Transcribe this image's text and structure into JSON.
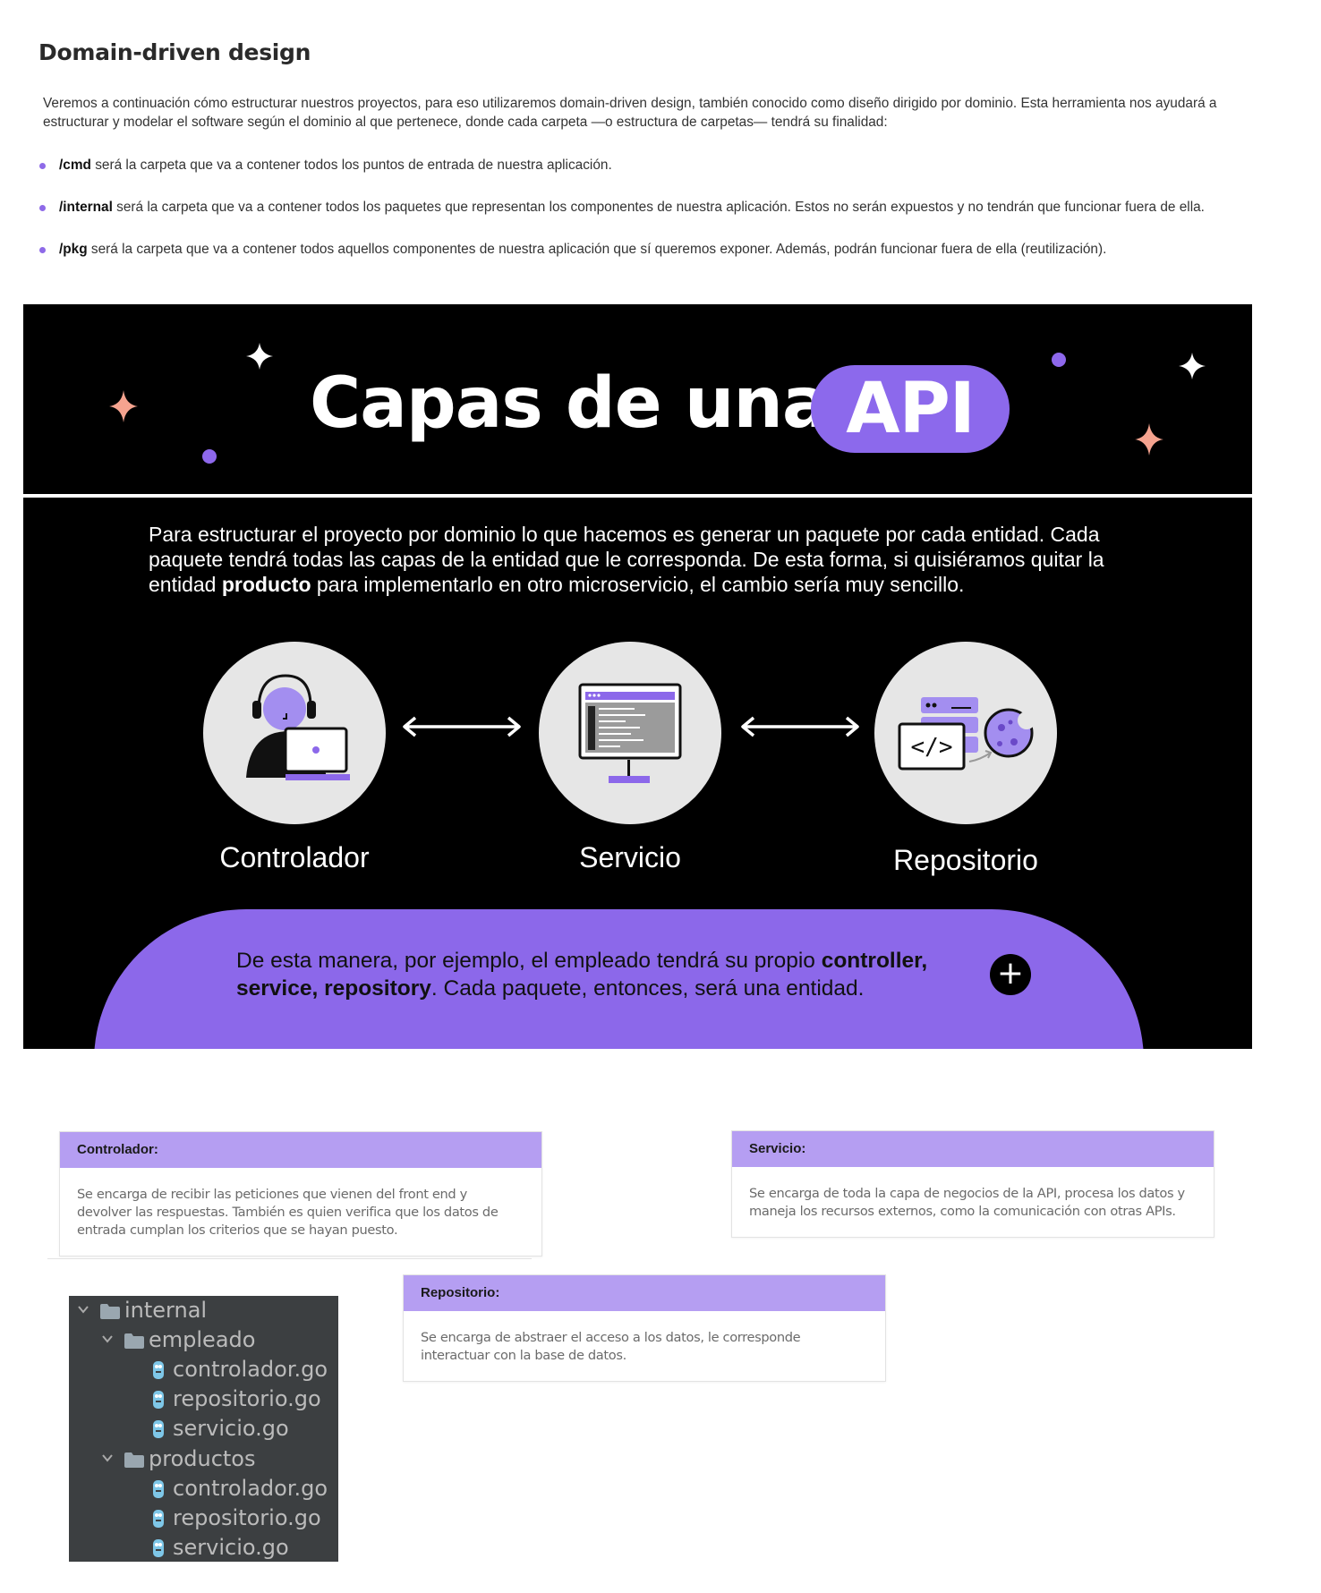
{
  "page": {
    "title": "Domain-driven design",
    "intro": "Veremos a continuación cómo estructurar nuestros proyectos, para eso utilizaremos domain-driven design, también conocido como diseño dirigido por dominio. Esta herramienta nos ayudará a estructurar y modelar el software según el dominio al que pertenece, donde cada carpeta —o estructura de carpetas— tendrá su finalidad:",
    "bullets": [
      {
        "term": "/cmd",
        "text": " será la carpeta que va a contener todos los puntos de entrada de nuestra aplicación."
      },
      {
        "term": "/internal",
        "text": " será la carpeta que va a contener todos los paquetes que representan los componentes de nuestra aplicación. Estos no serán expuestos y no tendrán que funcionar fuera de ella."
      },
      {
        "term": "/pkg",
        "text": " será la carpeta que va a contener todos aquellos componentes de nuestra aplicación que sí queremos exponer. Además, podrán funcionar fuera de ella (reutilización)."
      }
    ]
  },
  "infographic": {
    "title": "Capas de una",
    "title_highlight": "API",
    "description_part1": "Para estructurar el proyecto por dominio lo que hacemos es generar un paquete por cada entidad. Cada paquete tendrá todas las capas de la entidad que le corresponda. De esta forma, si quisiéramos quitar la entidad ",
    "description_bold": "producto",
    "description_part2": " para implementarlo en otro microservicio, el cambio sería muy sencillo.",
    "layers": [
      {
        "label": "Controlador",
        "icon": "user-laptop-icon"
      },
      {
        "label": "Servicio",
        "icon": "monitor-icon"
      },
      {
        "label": "Repositorio",
        "icon": "code-database-icon"
      }
    ],
    "bottom_part1": "De esta manera, por ejemplo, el empleado tendrá su propio ",
    "bottom_bold": "controller, service, repository",
    "bottom_part2": ". Cada paquete, entonces, será una entidad.",
    "plus_symbol": "+",
    "colors": {
      "accent": "#8c68ea",
      "background": "#000000",
      "sparkle_pink": "#f5a38f",
      "circle": "#e6e6e6"
    }
  },
  "cards": {
    "controlador": {
      "title": "Controlador:",
      "body": "Se encarga de recibir las peticiones que vienen del front end y devolver las respuestas. También es quien verifica que los datos de entrada cumplan los criterios que se hayan puesto."
    },
    "servicio": {
      "title": "Servicio:",
      "body": "Se encarga de toda la capa de negocios de la API, procesa los datos y maneja los recursos externos, como la comunicación con otras APIs."
    },
    "repositorio": {
      "title": "Repositorio:",
      "body": "Se encarga de abstraer el acceso a los datos, le corresponde interactuar con la base de datos."
    }
  },
  "file_tree": {
    "root": "internal",
    "folders": [
      {
        "name": "empleado",
        "files": [
          "controlador.go",
          "repositorio.go",
          "servicio.go"
        ]
      },
      {
        "name": "productos",
        "files": [
          "controlador.go",
          "repositorio.go",
          "servicio.go"
        ]
      }
    ]
  }
}
